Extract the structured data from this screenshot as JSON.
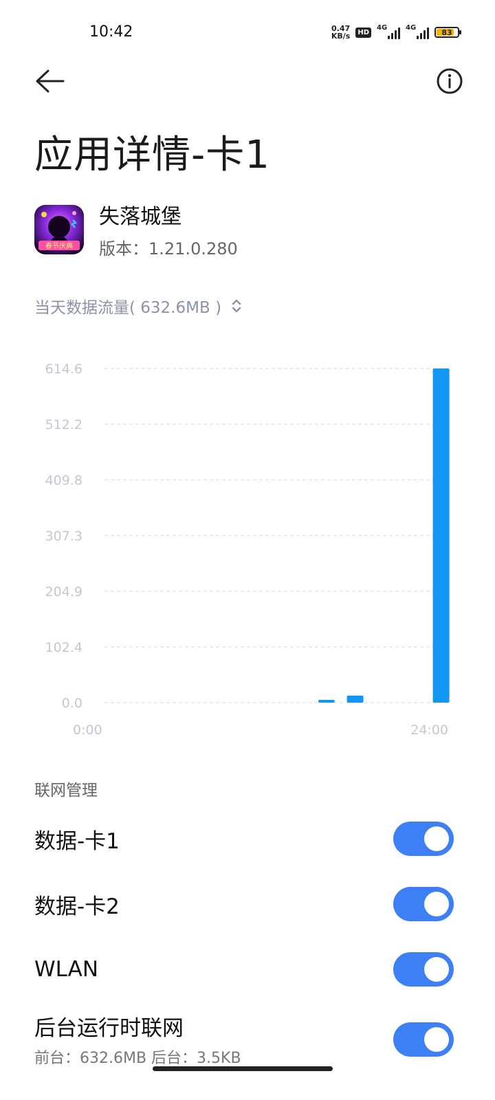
{
  "status_bar": {
    "time": "10:42",
    "net_speed_value": "0.47",
    "net_speed_unit": "KB/s",
    "hd_label": "HD",
    "network_1": "4G",
    "network_2": "4G",
    "battery_level": "83",
    "battery_color": "#f4b400"
  },
  "header": {
    "back_icon": "arrow-left-icon",
    "info_icon": "info-circle-icon",
    "title": "应用详情-卡1"
  },
  "app": {
    "name": "失落城堡",
    "version_label": "版本：1.21.0.280",
    "icon_caption": "春节庆典"
  },
  "usage_selector": {
    "label": "当天数据流量( 632.6MB )",
    "icon": "chevron-up-down-icon"
  },
  "chart_data": {
    "type": "bar",
    "ylim": [
      0,
      614.6
    ],
    "yticks": [
      "614.6",
      "512.2",
      "409.8",
      "307.3",
      "204.9",
      "102.4",
      "0.0"
    ],
    "xlim": [
      0,
      24
    ],
    "xticks": [
      "0:00",
      "24:00"
    ],
    "bar_color": "#1296f3",
    "bars": [
      {
        "hour": 15,
        "value": 5
      },
      {
        "hour": 17,
        "value": 13
      },
      {
        "hour": 23,
        "value": 614.6
      }
    ]
  },
  "network_section": {
    "header": "联网管理",
    "items": [
      {
        "label": "数据-卡1",
        "on": true
      },
      {
        "label": "数据-卡2",
        "on": true
      },
      {
        "label": "WLAN",
        "on": true
      },
      {
        "label": "后台运行时联网",
        "sub": "前台：632.6MB  后台：3.5KB",
        "on": true
      }
    ],
    "toggle_color": "#3d7ff5"
  }
}
